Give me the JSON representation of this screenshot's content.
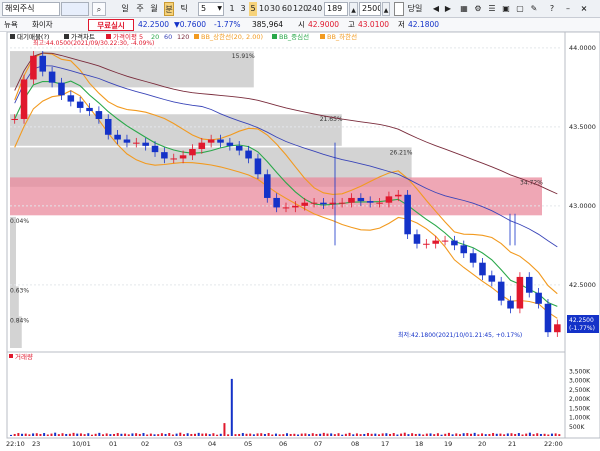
{
  "toolbar": {
    "symbol": "해외주식",
    "symbol_type": "",
    "periods": [
      "일",
      "주",
      "월",
      "분",
      "틱"
    ],
    "minutes": "5",
    "intervals": [
      "1",
      "3",
      "5",
      "10",
      "30",
      "60",
      "120",
      "240"
    ],
    "count": "189",
    "zoom": "2500",
    "timeframe": "당일",
    "close_icon": "close-icon"
  },
  "quotes": {
    "tab1": "뉴욕",
    "tab2": "화이자",
    "badge": "무료실시",
    "price": "42.2500",
    "change": "▼0.7600",
    "pct": "-1.77%",
    "volume": "385,964",
    "open_label": "시",
    "open": "42.9000",
    "high_label": "고",
    "high": "43.0100",
    "low_label": "저",
    "low": "42.1800"
  },
  "legend": {
    "title": "대기매물(?)",
    "price": "가격차트",
    "ma": "가격이평 5",
    "ma_periods": [
      "20",
      "60",
      "120"
    ],
    "bb": "BB_상한선(20, 2.00)",
    "mid": "BB_중심선",
    "lower": "BB_하한선"
  },
  "colors": {
    "up": "#e0182d",
    "down": "#1432c8",
    "bb": "#f29a1f",
    "mid": "#2aa84a",
    "ma_long": "#7a2c3c",
    "ma_blue": "#3a45b8",
    "volume_profile": "#c8c8c8",
    "volume_profile_max": "#e98a9c"
  },
  "chart_data": [
    {
      "type": "candlestick",
      "ylim": [
        42.1,
        44.05
      ],
      "y_ticks": [
        "44.0000",
        "43.5000",
        "43.0000",
        "42.5000"
      ],
      "x_ticks": [
        "22:10",
        "23",
        "10/01",
        "01",
        "02",
        "03",
        "04",
        "05",
        "06",
        "07",
        "08",
        "17",
        "18",
        "19",
        "20",
        "21",
        "22:00"
      ],
      "price_badge": {
        "price": "42.2500",
        "pct": "(-1.77%)"
      },
      "annotations": {
        "high": "최고:44.0500(2021/09/30.22:30, -4.09%)",
        "low": "최저:42.1800(2021/10/01.21:45, +0.17%)"
      },
      "volume_profile": {
        "labels": [
          "15.91%",
          "21.65%",
          "26.21%",
          "34.72%",
          "0.04%",
          "0.63%",
          "0.84%"
        ],
        "bands": [
          [
            43.75,
            43.98,
            15.91
          ],
          [
            43.38,
            43.58,
            21.65
          ],
          [
            43.12,
            43.37,
            26.21
          ],
          [
            42.94,
            43.18,
            34.72
          ],
          [
            42.49,
            42.93,
            0.04
          ],
          [
            42.3,
            42.49,
            0.63
          ],
          [
            42.1,
            42.3,
            0.84
          ]
        ]
      },
      "close": [
        43.55,
        43.8,
        43.95,
        43.85,
        43.78,
        43.7,
        43.66,
        43.62,
        43.6,
        43.55,
        43.45,
        43.42,
        43.4,
        43.4,
        43.38,
        43.34,
        43.3,
        43.3,
        43.32,
        43.36,
        43.4,
        43.42,
        43.4,
        43.38,
        43.35,
        43.3,
        43.2,
        43.05,
        42.99,
        42.99,
        43.0,
        43.02,
        43.02,
        43.01,
        43.02,
        43.02,
        43.05,
        43.03,
        43.02,
        43.02,
        43.06,
        43.07,
        42.82,
        42.76,
        42.76,
        42.78,
        42.78,
        42.75,
        42.7,
        42.64,
        42.56,
        42.52,
        42.4,
        42.35,
        42.55,
        42.45,
        42.38,
        42.2,
        42.25
      ]
    },
    {
      "type": "bar",
      "title": "거래량",
      "y_ticks": [
        "3,500K",
        "3,000K",
        "2,500K",
        "2,000K",
        "1,500K",
        "1,000K",
        "500K"
      ],
      "ylim": [
        0,
        3800
      ],
      "spike_index": 60,
      "spike_value": 3100
    }
  ]
}
